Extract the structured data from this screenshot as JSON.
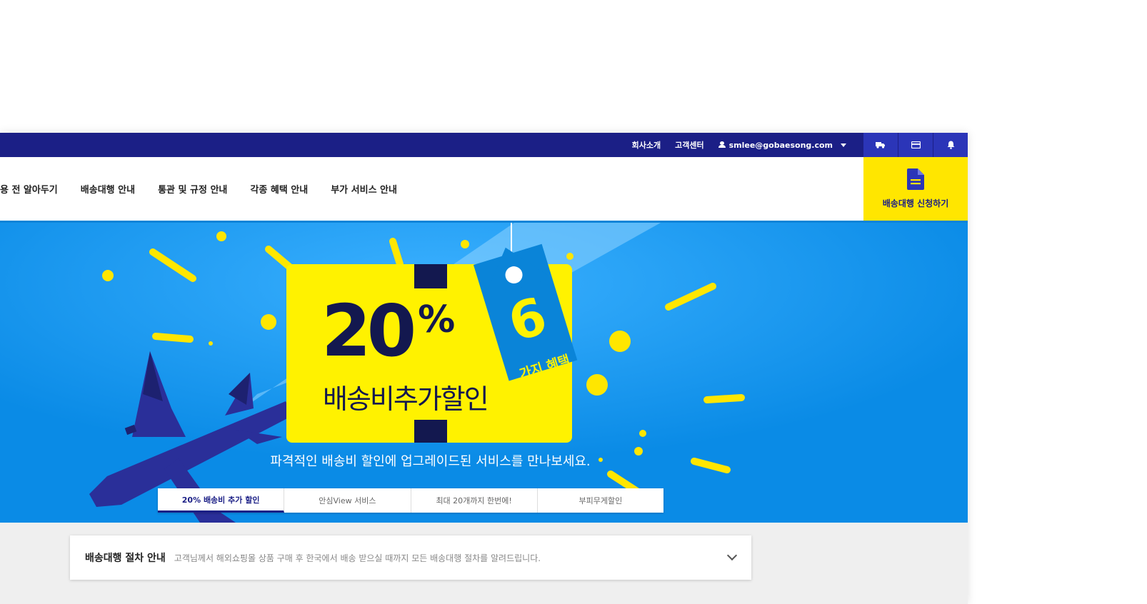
{
  "header": {
    "links": [
      "회사소개",
      "고객센터"
    ],
    "user_email": "smlee@gobaesong.com"
  },
  "icons": {
    "truck": "truck-icon",
    "card": "credit-card-icon",
    "bell": "bell-icon",
    "document": "document-icon"
  },
  "nav": {
    "items": [
      "이용 전 알아두기",
      "배송대행 안내",
      "통관 및 규정 안내",
      "각종 혜택 안내",
      "부가 서비스 안내"
    ],
    "apply_label": "배송대행 신청하기"
  },
  "banner": {
    "percent_value": "20",
    "percent_sign": "%",
    "coupon_sub": "배송비추가할인",
    "tag_number": "6",
    "tag_text": "가지 혜택",
    "caption": "파격적인 배송비 할인에 업그레이드된 서비스를 만나보세요.",
    "tabs": [
      "20% 배송비 추가 할인",
      "안심View 서비스",
      "최대 20개까지 한번에!",
      "부피무게할인"
    ],
    "active_tab_index": 0
  },
  "info": {
    "title": "배송대행 절차 안내",
    "description": "고객님께서 해외쇼핑몰 상품 구매 후 한국에서 배송 받으실 때까지 모든 배송대행 절차를 알려드립니다."
  },
  "colors": {
    "navy": "#1b1f86",
    "banner_blue": "#0a8be6",
    "yellow": "#ffe600"
  }
}
